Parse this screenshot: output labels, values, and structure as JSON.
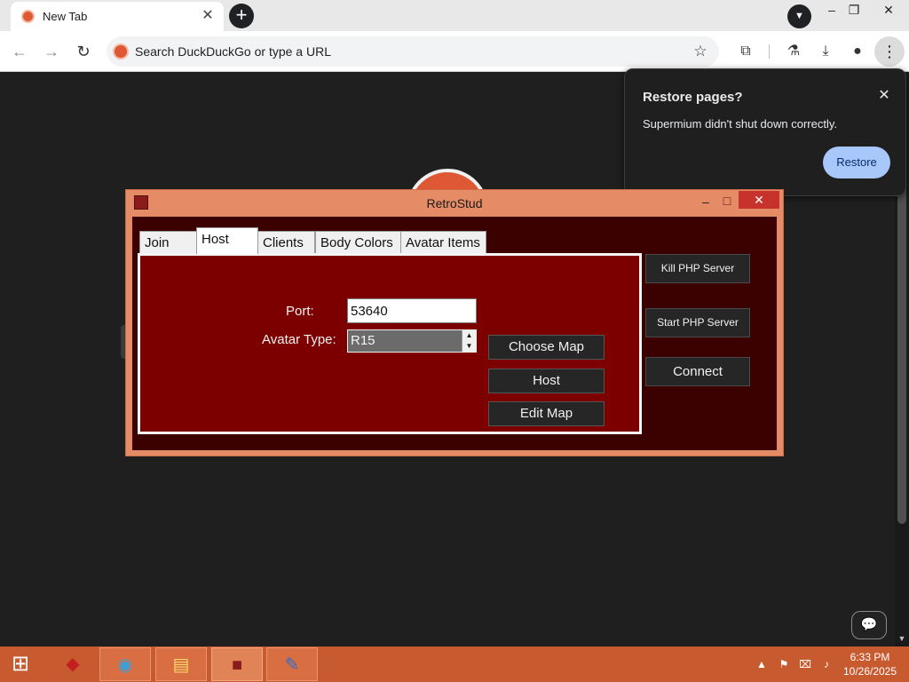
{
  "browser": {
    "tab_title": "New Tab",
    "omnibox_placeholder": "Search DuckDuckGo or type a URL"
  },
  "restore": {
    "title": "Restore pages?",
    "message": "Supermium didn't shut down correctly.",
    "button": "Restore"
  },
  "app": {
    "title": "RetroStud",
    "tabs": [
      "Join",
      "Host",
      "Clients",
      "Body Colors",
      "Avatar Items"
    ],
    "active_tab": "Host",
    "port_label": "Port:",
    "port_value": "53640",
    "avatar_label": "Avatar Type:",
    "avatar_value": "R15",
    "buttons": {
      "choose_map": "Choose Map",
      "host": "Host",
      "edit_map": "Edit Map",
      "kill_php": "Kill PHP Server",
      "start_php": "Start PHP Server",
      "connect": "Connect"
    }
  },
  "taskbar": {
    "time": "6:33 PM",
    "date": "10/26/2025"
  },
  "colors": {
    "window_frame": "#e58c66",
    "panel": "#7d0000",
    "client_bg": "#3b0000",
    "taskbar": "#c85a2f",
    "restore_button": "#a8c7fa"
  },
  "icons": [
    "duckduckgo-icon",
    "close-icon",
    "plus-icon",
    "chevron-down-icon",
    "minimize-icon",
    "maximize-icon",
    "back-arrow-icon",
    "forward-arrow-icon",
    "reload-icon",
    "star-icon",
    "extensions-icon",
    "labs-icon",
    "download-icon",
    "profile-icon",
    "kebab-menu-icon",
    "feedback-icon",
    "windows-logo-icon"
  ]
}
